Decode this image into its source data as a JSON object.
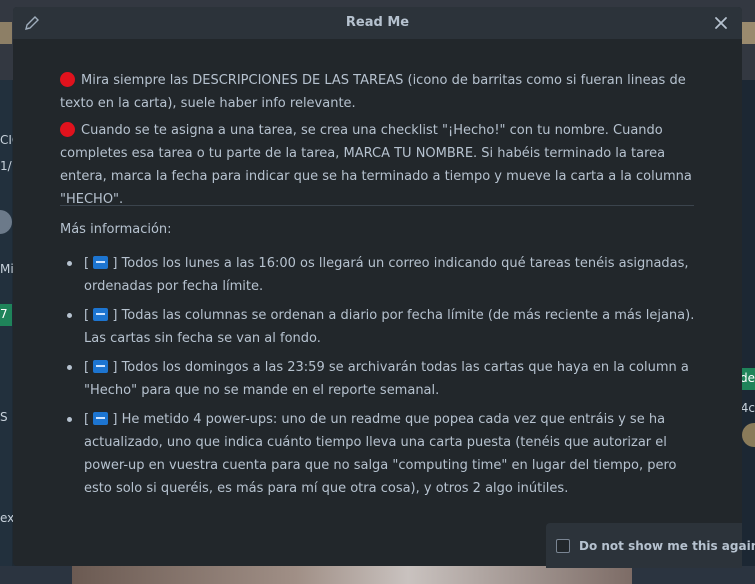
{
  "modal": {
    "title": "Read Me",
    "intro": [
      "Mira siempre las DESCRIPCIONES DE LAS TAREAS (icono de barritas como si fueran lineas de texto en la carta), suele haber info relevante.",
      "Cuando se te asigna a una tarea, se crea una checklist \"¡Hecho!\" con tu nombre. Cuando completes esa tarea o tu parte de la tarea, MARCA TU NOMBRE. Si habéis terminado la tarea entera, marca la fecha para indicar que se ha terminado a tiempo y mueve la carta a la columna \"HECHO\"."
    ],
    "more_heading": "Más información:",
    "items": [
      "Todos los lunes a las 16:00 os llegará un correo indicando qué tareas tenéis asignadas, ordenadas por fecha límite.",
      "Todas las columnas se ordenan a diario por fecha límite (de más reciente a más lejana). Las cartas sin fecha se van al fondo.",
      "Todos los domingos a las 23:59 se archivarán todas las cartas que haya en la column a \"Hecho\" para que no se mande en el reporte semanal.",
      "He metido 4 power-ups: uno de un readme que popea cada vez que entráis y se ha actualizado, uno que indica cuánto tiempo lleva una carta puesta (tenéis que autorizar el power-up en vuestra cuenta para que no salga \"computing time\" en lugar del tiempo, pero esto solo si queréis, es más para mí que otra cosa), y otros 2 algo inútiles."
    ],
    "bracket_open": "[",
    "bracket_close": "]",
    "dont_show_label": "Do not show me this again."
  },
  "background": {
    "left_fragments": [
      "CIC",
      "1/",
      "Mi",
      "7",
      "S",
      "ex"
    ],
    "right_fragments": [
      "de",
      "4c"
    ]
  },
  "colors": {
    "modal_bg": "#22272b",
    "header_bg": "#2c333a",
    "text": "#b6c2cf",
    "red_dot": "#e0121d",
    "new_badge": "#1d75d1"
  },
  "icons": [
    "edit-icon",
    "close-icon",
    "red-circle-icon",
    "new-badge-icon",
    "checkbox-icon"
  ]
}
